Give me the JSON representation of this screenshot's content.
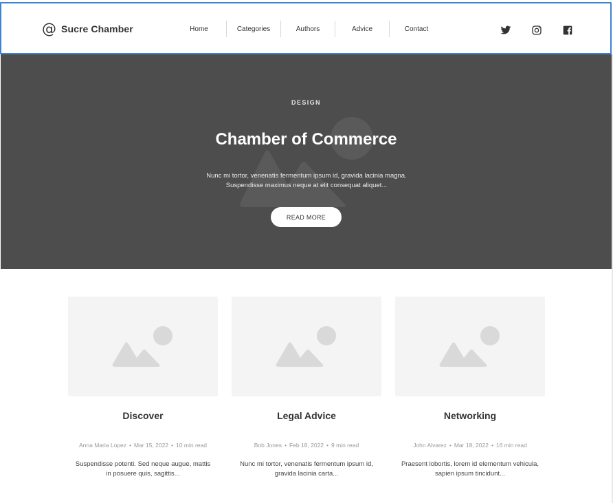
{
  "header": {
    "brand": "Sucre Chamber",
    "nav": [
      "Home",
      "Categories",
      "Authors",
      "Advice",
      "Contact"
    ],
    "social_icons": [
      "twitter-icon",
      "instagram-icon",
      "facebook-icon"
    ]
  },
  "hero": {
    "kicker": "DESIGN",
    "title": "Chamber of Commerce",
    "text": "Nunc mi tortor, venenatis fermentum ipsum id, gravida lacinia magna. Suspendisse maximus neque at elit consequat aliquet...",
    "button": "READ MORE"
  },
  "cards": [
    {
      "title": "Discover",
      "author": "Anna Maria Lopez",
      "date": "Mar 15, 2022",
      "read": "10 min read",
      "excerpt": "Suspendisse potenti. Sed neque augue, mattis in posuere quis, sagittis..."
    },
    {
      "title": "Legal Advice",
      "author": "Bob Jones",
      "date": "Feb 18, 2022",
      "read": "9 min read",
      "excerpt": "Nunc mi tortor, venenatis fermentum ipsum id, gravida lacinia carta..."
    },
    {
      "title": "Networking",
      "author": "John Alvarez",
      "date": "Mar 18, 2022",
      "read": "16 min read",
      "excerpt": "Praesent lobortis, lorem id elementum vehicula, sapien ipsum tincidunt..."
    }
  ],
  "colors": {
    "hero_bg": "#4d4d4d",
    "header_border": "#3b82d6",
    "placeholder_bg": "#f4f4f4",
    "placeholder_shape": "#d9d9d9"
  }
}
